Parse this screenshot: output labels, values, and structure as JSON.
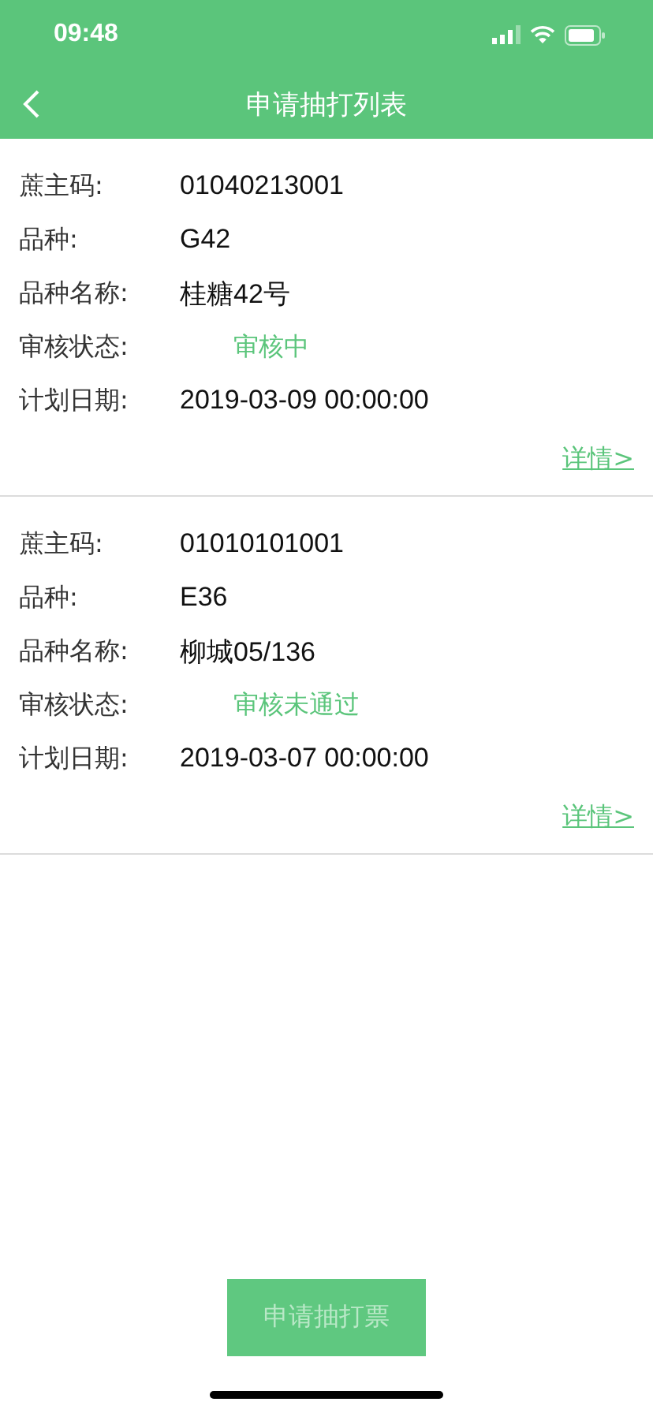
{
  "status_bar": {
    "time": "09:48"
  },
  "nav": {
    "title": "申请抽打列表"
  },
  "records": [
    {
      "fields": [
        {
          "label": "蔗主码:",
          "value": "01040213001",
          "kind": "plain"
        },
        {
          "label": "品种:",
          "value": "G42",
          "kind": "plain"
        },
        {
          "label": "品种名称:",
          "value": "桂糖42号",
          "kind": "plain"
        },
        {
          "label": "审核状态:",
          "value": "审核中",
          "kind": "status"
        },
        {
          "label": "计划日期:",
          "value": "2019-03-09 00:00:00",
          "kind": "plain"
        }
      ],
      "link": "详情>"
    },
    {
      "fields": [
        {
          "label": "蔗主码:",
          "value": "01010101001",
          "kind": "plain"
        },
        {
          "label": "品种:",
          "value": "E36",
          "kind": "plain"
        },
        {
          "label": "品种名称:",
          "value": "柳城05/136",
          "kind": "plain"
        },
        {
          "label": "审核状态:",
          "value": "审核未通过",
          "kind": "status"
        },
        {
          "label": "计划日期:",
          "value": "2019-03-07 00:00:00",
          "kind": "plain"
        }
      ],
      "link": "详情>"
    }
  ],
  "apply_button": {
    "label": "申请抽打票",
    "disabled": true
  }
}
